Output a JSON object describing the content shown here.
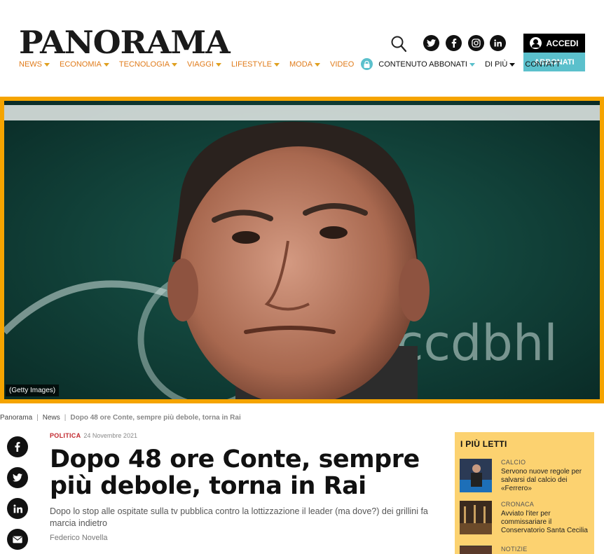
{
  "site": {
    "logo": "PANORAMA"
  },
  "header": {
    "social": [
      {
        "icon": "twitter-icon",
        "glyph": "t"
      },
      {
        "icon": "facebook-icon",
        "glyph": "f"
      },
      {
        "icon": "instagram-icon",
        "glyph": "◎"
      },
      {
        "icon": "linkedin-icon",
        "glyph": "in"
      }
    ],
    "accedi_label": "ACCEDI",
    "abbonati_label": "ABBONATI"
  },
  "nav": {
    "items": [
      {
        "label": "NEWS"
      },
      {
        "label": "ECONOMIA"
      },
      {
        "label": "TECNOLOGIA"
      },
      {
        "label": "VIAGGI"
      },
      {
        "label": "LIFESTYLE"
      },
      {
        "label": "MODA"
      },
      {
        "label": "VIDEO"
      }
    ],
    "contenuto_abbonati": "CONTENUTO ABBONATI",
    "di_piu": "DI PIÙ",
    "contatti": "CONTATT"
  },
  "hero": {
    "caption": "(Getty Images)"
  },
  "breadcrumb": {
    "home": "Panorama",
    "section": "News",
    "current": "Dopo 48 ore Conte, sempre più debole, torna in Rai",
    "separator": "|"
  },
  "article": {
    "category": "POLITICA",
    "date": "24 Novembre 2021",
    "title": "Dopo 48 ore Conte, sempre più debole, torna in Rai",
    "subtitle": "Dopo lo stop alle ospitate sulla tv pubblica contro la lottizzazione il leader (ma dove?) dei grillini fa marcia indietro",
    "author": "Federico Novella"
  },
  "share": [
    {
      "icon": "facebook-icon",
      "glyph": "f"
    },
    {
      "icon": "twitter-icon",
      "glyph": "t"
    },
    {
      "icon": "linkedin-icon",
      "glyph": "in"
    },
    {
      "icon": "email-icon",
      "glyph": "✉"
    }
  ],
  "most_read": {
    "heading": "I PIÙ LETTI",
    "items": [
      {
        "category": "CALCIO",
        "text": "Servono nuove regole per salvarsi dal calcio dei «Ferrero»"
      },
      {
        "category": "CRONACA",
        "text": "Avviato l'iter per commissariare il Conservatorio Santa Cecilia"
      },
      {
        "category": "NOTIZIE",
        "text": ""
      }
    ]
  },
  "colors": {
    "accent": "#e07b1a",
    "teal": "#5bc0cc",
    "hero_border": "#f5a400",
    "sidebar": "#fcd270",
    "category": "#c1272d"
  }
}
